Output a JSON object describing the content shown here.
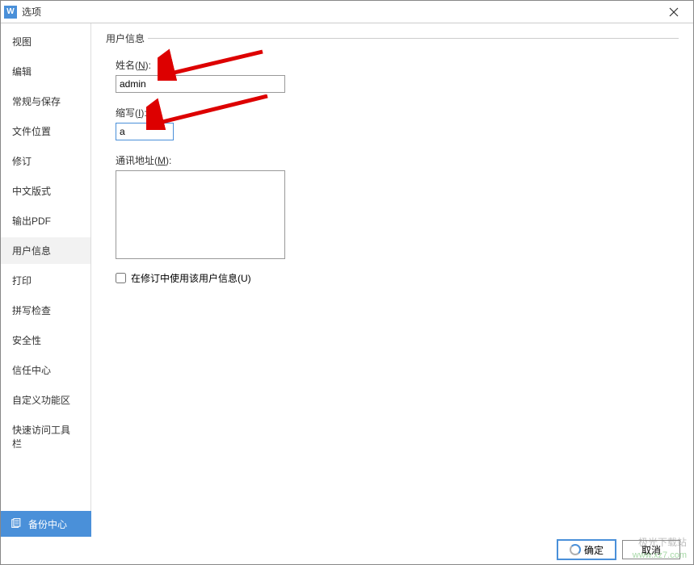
{
  "titlebar": {
    "icon_letter": "W",
    "title": "选项"
  },
  "sidebar": {
    "items": [
      {
        "label": "视图"
      },
      {
        "label": "编辑"
      },
      {
        "label": "常规与保存"
      },
      {
        "label": "文件位置"
      },
      {
        "label": "修订"
      },
      {
        "label": "中文版式"
      },
      {
        "label": "输出PDF"
      },
      {
        "label": "用户信息"
      },
      {
        "label": "打印"
      },
      {
        "label": "拼写检查"
      },
      {
        "label": "安全性"
      },
      {
        "label": "信任中心"
      },
      {
        "label": "自定义功能区"
      },
      {
        "label": "快速访问工具栏"
      }
    ],
    "backup_center": "备份中心"
  },
  "content": {
    "legend": "用户信息",
    "fields": {
      "name": {
        "label_prefix": "姓名(",
        "mnemonic": "N",
        "label_suffix": "):",
        "value": "admin"
      },
      "initial": {
        "label_prefix": "缩写(",
        "mnemonic": "I",
        "label_suffix": "):",
        "value": "a"
      },
      "address": {
        "label_prefix": "通讯地址(",
        "mnemonic": "M",
        "label_suffix": "):",
        "value": ""
      }
    },
    "checkbox": {
      "label_prefix": "在修订中使用该用户信息(",
      "mnemonic": "U",
      "label_suffix": ")",
      "checked": false
    }
  },
  "footer": {
    "ok": "确定",
    "cancel": "取消"
  },
  "watermark": {
    "line1": "极光下载站",
    "line2": "www.xz7.com"
  }
}
